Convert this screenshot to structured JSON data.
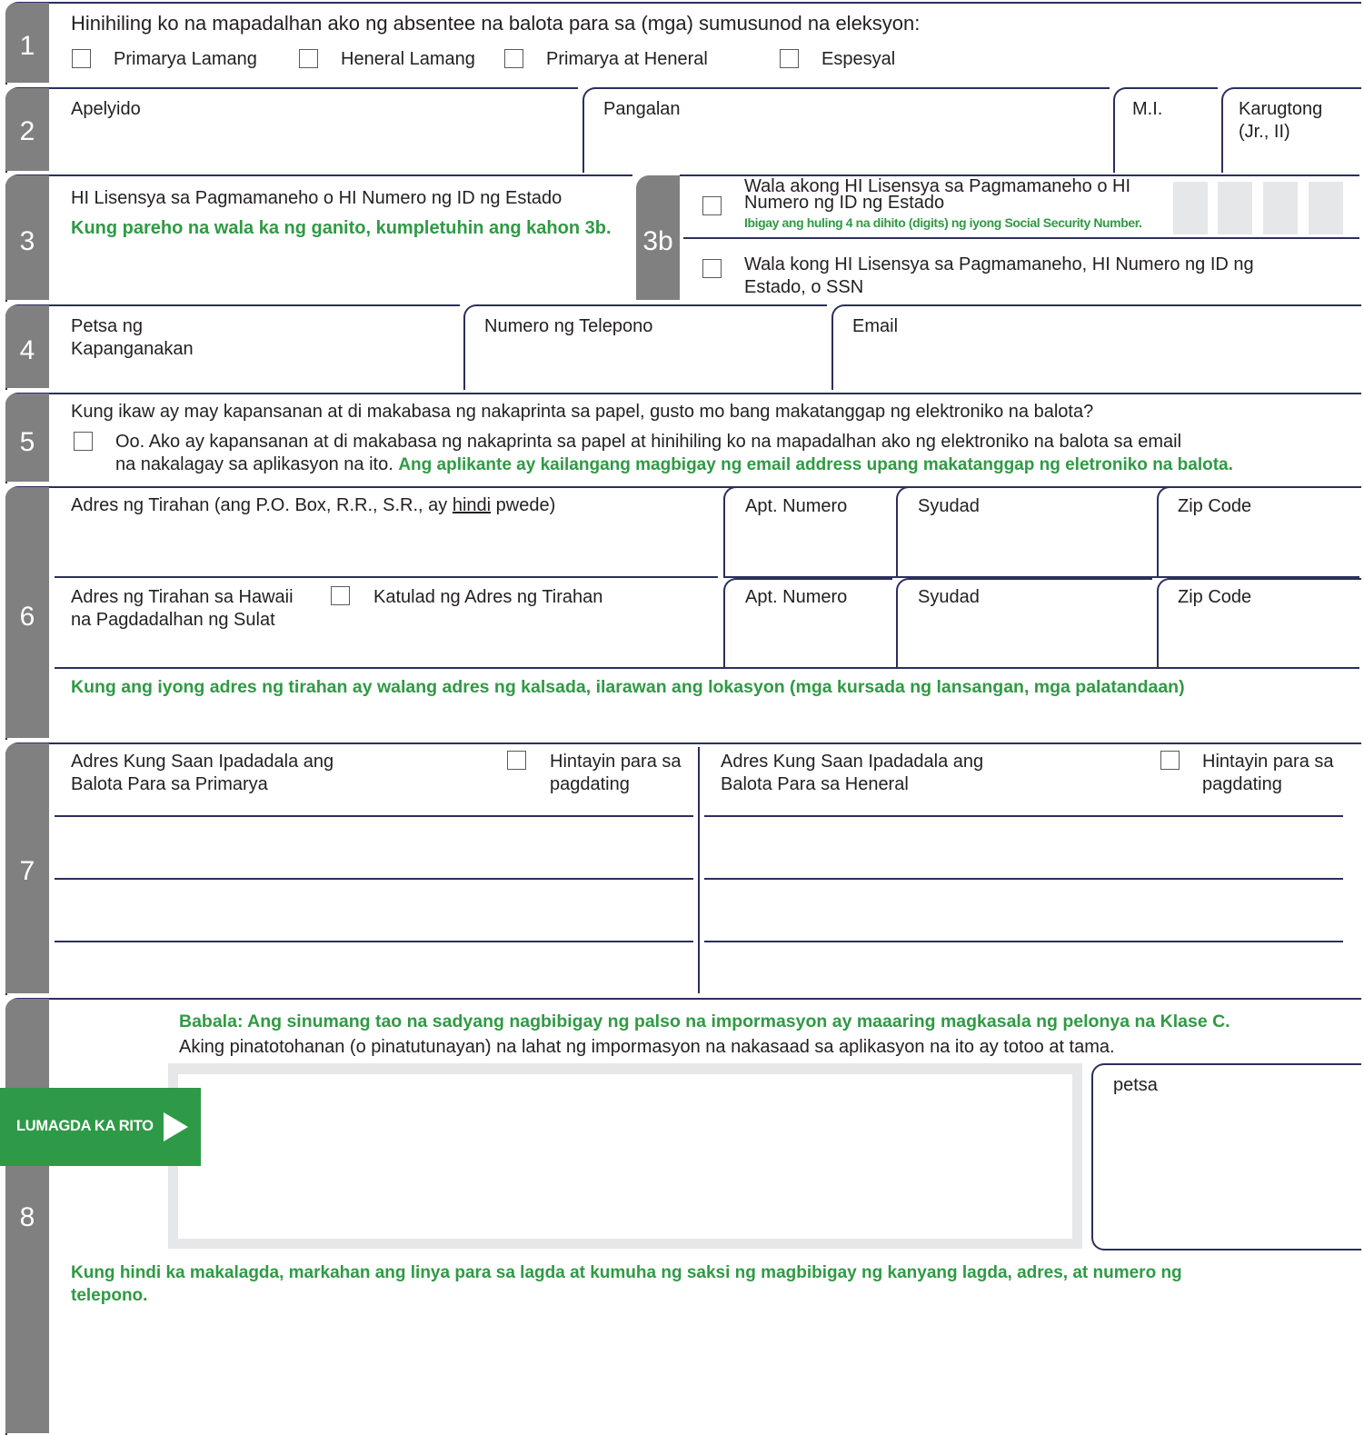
{
  "s1": {
    "num": "1",
    "question": "Hinihiling ko na mapadalhan ako ng absentee na balota para sa (mga) sumusunod na eleksyon:",
    "options": [
      "Primarya Lamang",
      "Heneral Lamang",
      "Primarya at Heneral",
      "Espesyal"
    ]
  },
  "s2": {
    "num": "2",
    "last": "Apelyido",
    "first": "Pangalan",
    "mi": "M.I.",
    "suffix_1": "Karugtong",
    "suffix_2": "(Jr., II)"
  },
  "s3": {
    "num": "3",
    "label": "HI Lisensya sa Pagmamaneho o HI Numero ng ID ng Estado",
    "note": "Kung pareho na wala ka ng ganito, kumpletuhin ang kahon 3b.",
    "b_num": "3b",
    "opt1_line1": "Wala akong HI Lisensya sa Pagmamaneho o HI",
    "opt1_line2": "Numero ng ID ng Estado",
    "opt1_note": "Ibigay ang huling 4 na dihito (digits) ng iyong Social Security Number.",
    "opt2_line1": "Wala kong HI Lisensya sa Pagmamaneho, HI Numero ng ID ng",
    "opt2_line2": "Estado, o SSN"
  },
  "s4": {
    "num": "4",
    "dob_1": "Petsa ng",
    "dob_2": "Kapanganakan",
    "phone": "Numero ng Telepono",
    "email": "Email"
  },
  "s5": {
    "num": "5",
    "question": "Kung ikaw ay may kapansanan at di makabasa ng nakaprinta sa papel, gusto mo bang makatanggap ng elektroniko na balota?",
    "answer_1": "Oo. Ako ay kapansanan at di makabasa ng nakaprinta sa papel at hinihiling ko na mapadalhan ako ng elektroniko na balota sa email",
    "answer_2": "na nakalagay sa aplikasyon na ito.",
    "answer_note": "Ang aplikante ay kailangang magbigay ng email address upang makatanggap ng eletroniko na balota."
  },
  "s6": {
    "num": "6",
    "res_a": "Adres ng Tirahan (ang P.O. Box, R.R., S.R., ay ",
    "res_b": "hindi",
    "res_c": " pwede)",
    "apt": "Apt. Numero",
    "city": "Syudad",
    "zip": "Zip Code",
    "mail_1": "Adres ng Tirahan sa Hawaii",
    "mail_2": "na Pagdadalhan ng Sulat",
    "same": "Katulad ng Adres ng Tirahan",
    "note": "Kung ang iyong adres ng tirahan ay walang adres ng kalsada, ilarawan ang lokasyon (mga kursada ng lansangan, mga palatandaan)"
  },
  "s7": {
    "num": "7",
    "primary_1": "Adres Kung Saan Ipadadala ang",
    "primary_2": "Balota Para sa Primarya",
    "general_1": "Adres Kung Saan Ipadadala ang",
    "general_2": "Balota Para sa Heneral",
    "wait_1": "Hintayin para sa",
    "wait_2": "pagdating"
  },
  "s8": {
    "num": "8",
    "warning": "Babala: Ang sinumang tao na sadyang nagbibigay ng palso na impormasyon ay maaaring magkasala ng pelonya na Klase C.",
    "certify": "Aking pinatotohanan (o pinatutunayan) na lahat ng impormasyon na nakasaad sa aplikasyon na ito ay totoo at tama.",
    "sign_here": "LUMAGDA KA RITO",
    "date": "petsa",
    "note_1": "Kung hindi ka makalagda, markahan ang linya para sa lagda at kumuha ng saksi ng magbibigay ng kanyang lagda, adres, at numero ng",
    "note_2": "telepono."
  },
  "colors": {
    "navy": "#2b2f5c",
    "green": "#2f9a44",
    "gray_bar": "#808080",
    "sign_green": "#2e9a47"
  }
}
